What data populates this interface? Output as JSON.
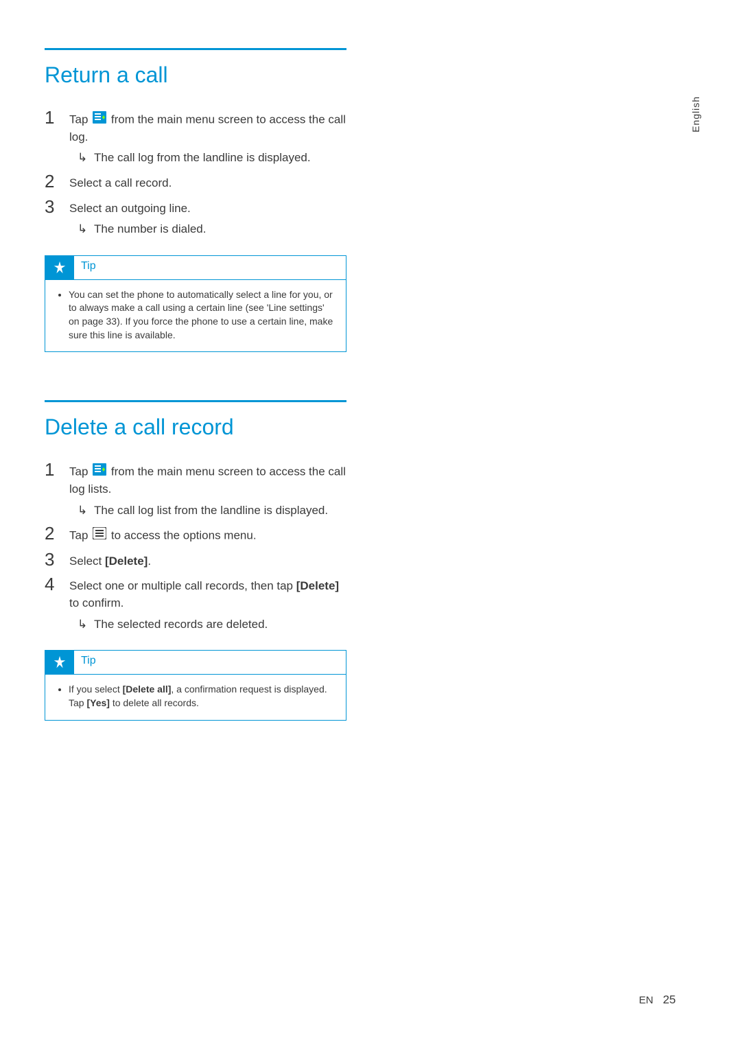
{
  "lang_tab": "English",
  "sections": [
    {
      "title": "Return a call",
      "steps": [
        {
          "num": "1",
          "pre": "Tap ",
          "icon": "call-log-icon",
          "post": " from the main menu screen to access the call log.",
          "results": [
            "The call log from the landline is displayed."
          ]
        },
        {
          "num": "2",
          "text": "Select a call record."
        },
        {
          "num": "3",
          "text": "Select an outgoing line.",
          "results": [
            "The number is dialed."
          ]
        }
      ],
      "tip": {
        "label": "Tip",
        "text": "You can set the phone to automatically select a line for you, or to always make a call using a certain line (see 'Line settings' on page 33). If you force the phone to use a certain line, make sure this line is available."
      }
    },
    {
      "title": "Delete a call record",
      "steps": [
        {
          "num": "1",
          "pre": "Tap ",
          "icon": "call-log-icon",
          "post": " from the main menu screen to access the call log lists.",
          "results": [
            "The call log list from the landline is displayed."
          ]
        },
        {
          "num": "2",
          "pre": "Tap ",
          "icon": "options-menu-icon",
          "post": " to access the options menu."
        },
        {
          "num": "3",
          "pre_text": "Select ",
          "bold": "[Delete]",
          "post_text": "."
        },
        {
          "num": "4",
          "pre_text": "Select one or multiple call records, then tap ",
          "bold": "[Delete]",
          "post_text": " to confirm.",
          "results": [
            "The selected records are deleted."
          ]
        }
      ],
      "tip": {
        "label": "Tip",
        "pre": "If you select ",
        "b1": "[Delete all]",
        "mid": ", a confirmation request is displayed. Tap ",
        "b2": "[Yes]",
        "post": " to delete all records."
      }
    }
  ],
  "footer": {
    "lang": "EN",
    "page": "25"
  }
}
